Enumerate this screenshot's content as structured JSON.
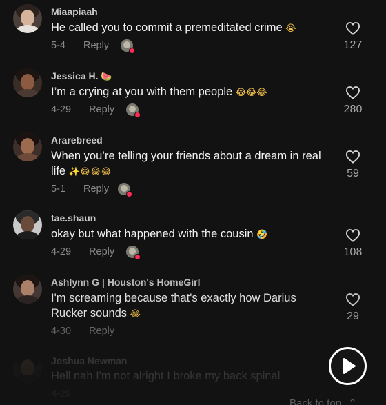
{
  "comments": [
    {
      "username": "Miaapiaah",
      "username_emoji": "",
      "text": "He called you to commit a premeditated crime",
      "text_emoji": "😭",
      "date": "5-4",
      "reply_label": "Reply",
      "likes": "127"
    },
    {
      "username": "Jessica H.",
      "username_emoji": "🍉",
      "text": "I’m a crying at you with them people",
      "text_emoji": "😂😂😂",
      "date": "4-29",
      "reply_label": "Reply",
      "likes": "280"
    },
    {
      "username": "Ararebreed",
      "username_emoji": "",
      "text": "When you’re telling your friends about a dream in real life",
      "text_emoji": "✨😂😂😂",
      "date": "5-1",
      "reply_label": "Reply",
      "likes": "59"
    },
    {
      "username": "tae.shaun",
      "username_emoji": "",
      "text": "okay but what happened with the cousin",
      "text_emoji": "🤣",
      "date": "4-29",
      "reply_label": "Reply",
      "likes": "108"
    },
    {
      "username": "Ashlynn G | Houston's HomeGirl",
      "username_emoji": "",
      "text": "I'm screaming because that's exactly how Darius Rucker sounds",
      "text_emoji": "😂",
      "date": "4-30",
      "reply_label": "Reply",
      "likes": "29"
    },
    {
      "username": "Joshua Newman",
      "username_emoji": "",
      "text": "Hell nah I'm not alright I broke my back spinal",
      "text_emoji": "",
      "date": "4-29",
      "reply_label": "Reply",
      "likes": ""
    }
  ],
  "back_to_top_label": "Back to top",
  "icons": {
    "like": "heart-outline-icon",
    "play": "play-icon",
    "liked_by_creator": "creator-liked-icon",
    "back_to_top": "chevron-up-icon"
  },
  "colors": {
    "background": "#121212",
    "accent": "#fe2c55",
    "text": "#f2f2f2",
    "muted": "#8a8a8a"
  }
}
